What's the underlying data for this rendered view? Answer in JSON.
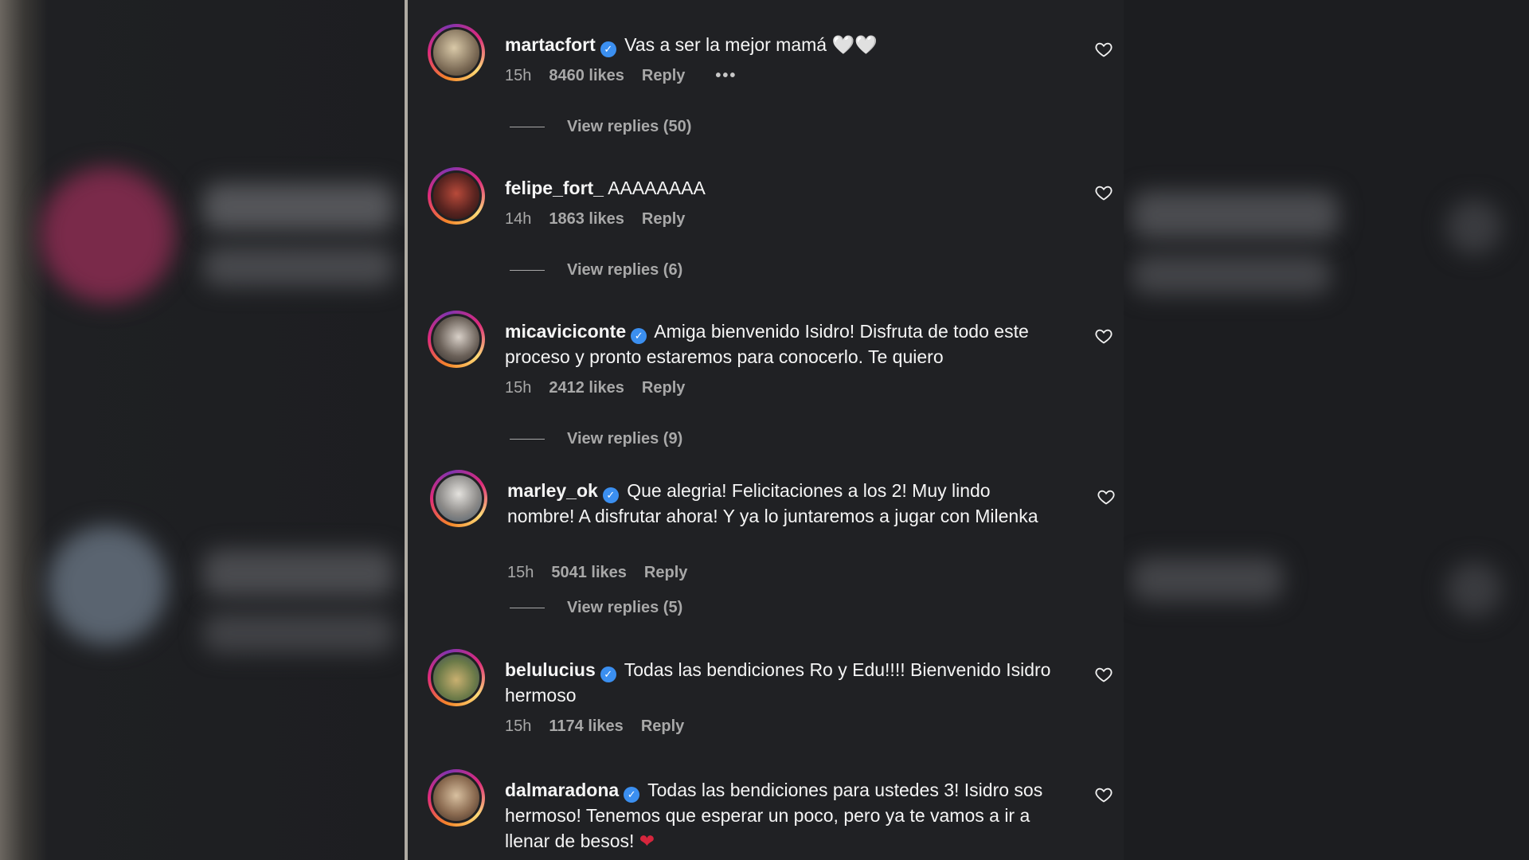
{
  "comments": [
    {
      "username": "martacfort",
      "verified": true,
      "text": "Vas a ser la mejor mamá 🤍🤍",
      "time": "15h",
      "likes": "8460 likes",
      "reply": "Reply",
      "more": "•••",
      "view_replies": "View replies (50)"
    },
    {
      "username": "felipe_fort_",
      "verified": false,
      "text": "AAAAAAAA",
      "time": "14h",
      "likes": "1863 likes",
      "reply": "Reply",
      "view_replies": "View replies (6)"
    },
    {
      "username": "micaviciconte",
      "verified": true,
      "text": "Amiga bienvenido Isidro! Disfruta de todo este proceso y pronto estaremos para conocerlo. Te quiero",
      "time": "15h",
      "likes": "2412 likes",
      "reply": "Reply",
      "view_replies": "View replies (9)"
    },
    {
      "username": "marley_ok",
      "verified": true,
      "text": "Que alegria! Felicitaciones a los 2! Muy lindo nombre! A disfrutar ahora! Y ya lo juntaremos a jugar con Milenka",
      "time": "15h",
      "likes": "5041 likes",
      "reply": "Reply",
      "view_replies": "View replies (5)"
    },
    {
      "username": "belulucius",
      "verified": true,
      "text": "Todas las bendiciones Ro y Edu!!!! Bienvenido Isidro hermoso",
      "time": "15h",
      "likes": "1174 likes",
      "reply": "Reply"
    },
    {
      "username": "dalmaradona",
      "verified": true,
      "text": "Todas las bendiciones para ustedes 3! Isidro sos hermoso! Tenemos que esperar un poco, pero ya te vamos a ir a llenar de besos!",
      "emoji": "❤",
      "time": "",
      "likes": "",
      "reply": ""
    }
  ],
  "icons": {
    "verified": "✓",
    "like": "heart-outline-icon"
  },
  "colors": {
    "verified_badge": "#3b8ff0",
    "panel_bg": "#202124",
    "secondary_text": "#a8a8a8"
  }
}
